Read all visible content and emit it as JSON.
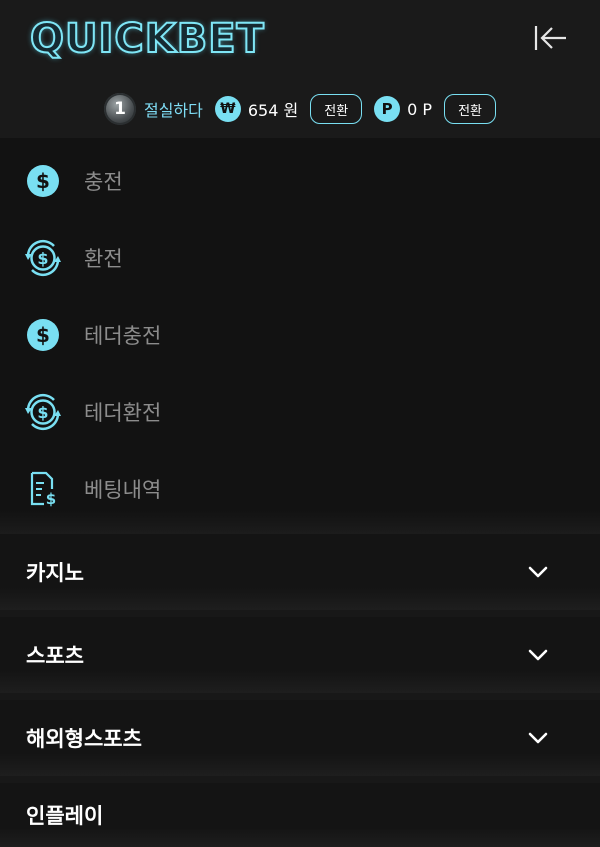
{
  "header": {
    "logo_text": "QUICKBET",
    "close_icon": "collapse-arrow-left-icon"
  },
  "user": {
    "level": "1",
    "username": "절실하다",
    "won_symbol": "₩",
    "balance": "654 원",
    "point_symbol": "P",
    "points": "0 P",
    "switch_label_balance": "전환",
    "switch_label_points": "전환"
  },
  "menu": {
    "items": [
      {
        "label": "충전",
        "icon": "dollar-coin-icon"
      },
      {
        "label": "환전",
        "icon": "dollar-exchange-icon"
      },
      {
        "label": "테더충전",
        "icon": "dollar-coin-icon"
      },
      {
        "label": "테더환전",
        "icon": "dollar-exchange-icon"
      },
      {
        "label": "베팅내역",
        "icon": "receipt-dollar-icon"
      }
    ]
  },
  "sections": [
    {
      "label": "카지노",
      "icon": "chevron-down-icon"
    },
    {
      "label": "스포츠",
      "icon": "chevron-down-icon"
    },
    {
      "label": "해외형스포츠",
      "icon": "chevron-down-icon"
    },
    {
      "label": "인플레이"
    }
  ],
  "colors": {
    "accent": "#79dff2",
    "background": "#181818",
    "menu_text": "#8c8c8c"
  }
}
